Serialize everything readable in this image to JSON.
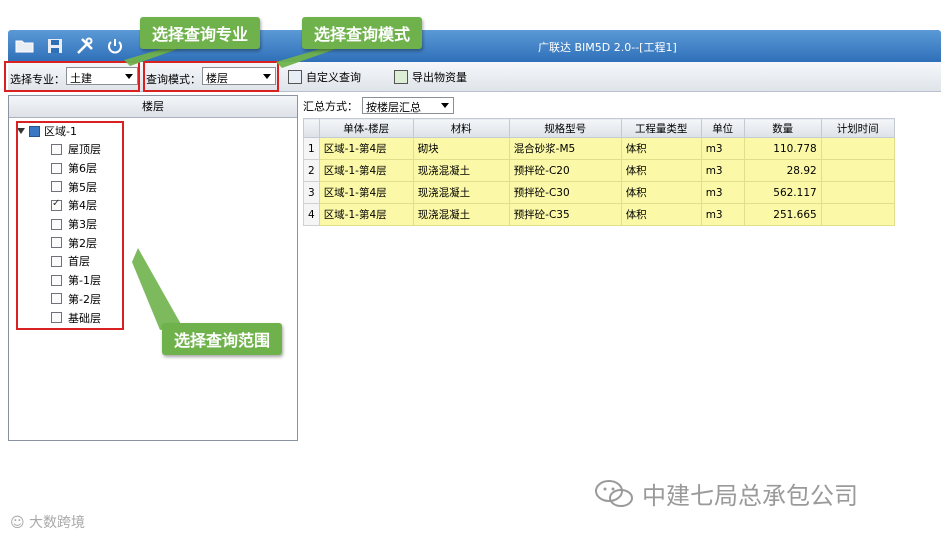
{
  "window": {
    "title": "广联达 BIM5D 2.0--[工程1]"
  },
  "toolbar": {
    "major_label": "选择专业：",
    "major_value": "土建",
    "mode_label": "查询模式：",
    "mode_value": "楼层",
    "custom_query": "自定义查询",
    "export": "导出物资量"
  },
  "left_panel": {
    "header": "楼层",
    "root": "区域-1",
    "floors": [
      {
        "label": "屋顶层",
        "checked": false
      },
      {
        "label": "第6层",
        "checked": false
      },
      {
        "label": "第5层",
        "checked": false
      },
      {
        "label": "第4层",
        "checked": true
      },
      {
        "label": "第3层",
        "checked": false
      },
      {
        "label": "第2层",
        "checked": false
      },
      {
        "label": "首层",
        "checked": false
      },
      {
        "label": "第-1层",
        "checked": false
      },
      {
        "label": "第-2层",
        "checked": false
      },
      {
        "label": "基础层",
        "checked": false
      }
    ]
  },
  "summary": {
    "label": "汇总方式：",
    "value": "按楼层汇总"
  },
  "table": {
    "headers": [
      "单体-楼层",
      "材料",
      "规格型号",
      "工程量类型",
      "单位",
      "数量",
      "计划时间"
    ],
    "rows": [
      {
        "n": "1",
        "unit_floor": "区域-1-第4层",
        "material": "砌块",
        "spec": "混合砂浆-M5",
        "qty_type": "体积",
        "unit": "m3",
        "qty": "110.778",
        "time": ""
      },
      {
        "n": "2",
        "unit_floor": "区域-1-第4层",
        "material": "现浇混凝土",
        "spec": "预拌砼-C20",
        "qty_type": "体积",
        "unit": "m3",
        "qty": "28.92",
        "time": ""
      },
      {
        "n": "3",
        "unit_floor": "区域-1-第4层",
        "material": "现浇混凝土",
        "spec": "预拌砼-C30",
        "qty_type": "体积",
        "unit": "m3",
        "qty": "562.117",
        "time": ""
      },
      {
        "n": "4",
        "unit_floor": "区域-1-第4层",
        "material": "现浇混凝土",
        "spec": "预拌砼-C35",
        "qty_type": "体积",
        "unit": "m3",
        "qty": "251.665",
        "time": ""
      }
    ]
  },
  "callouts": {
    "major": "选择查询专业",
    "mode": "选择查询模式",
    "range": "选择查询范围"
  },
  "watermark": {
    "right": "中建七局总承包公司",
    "left": "大数跨境"
  },
  "colors": {
    "highlight": "#d92121",
    "callout": "#6fb24c",
    "row_fill": "#fbf9a7",
    "titlebar": "#2f6fb8"
  }
}
